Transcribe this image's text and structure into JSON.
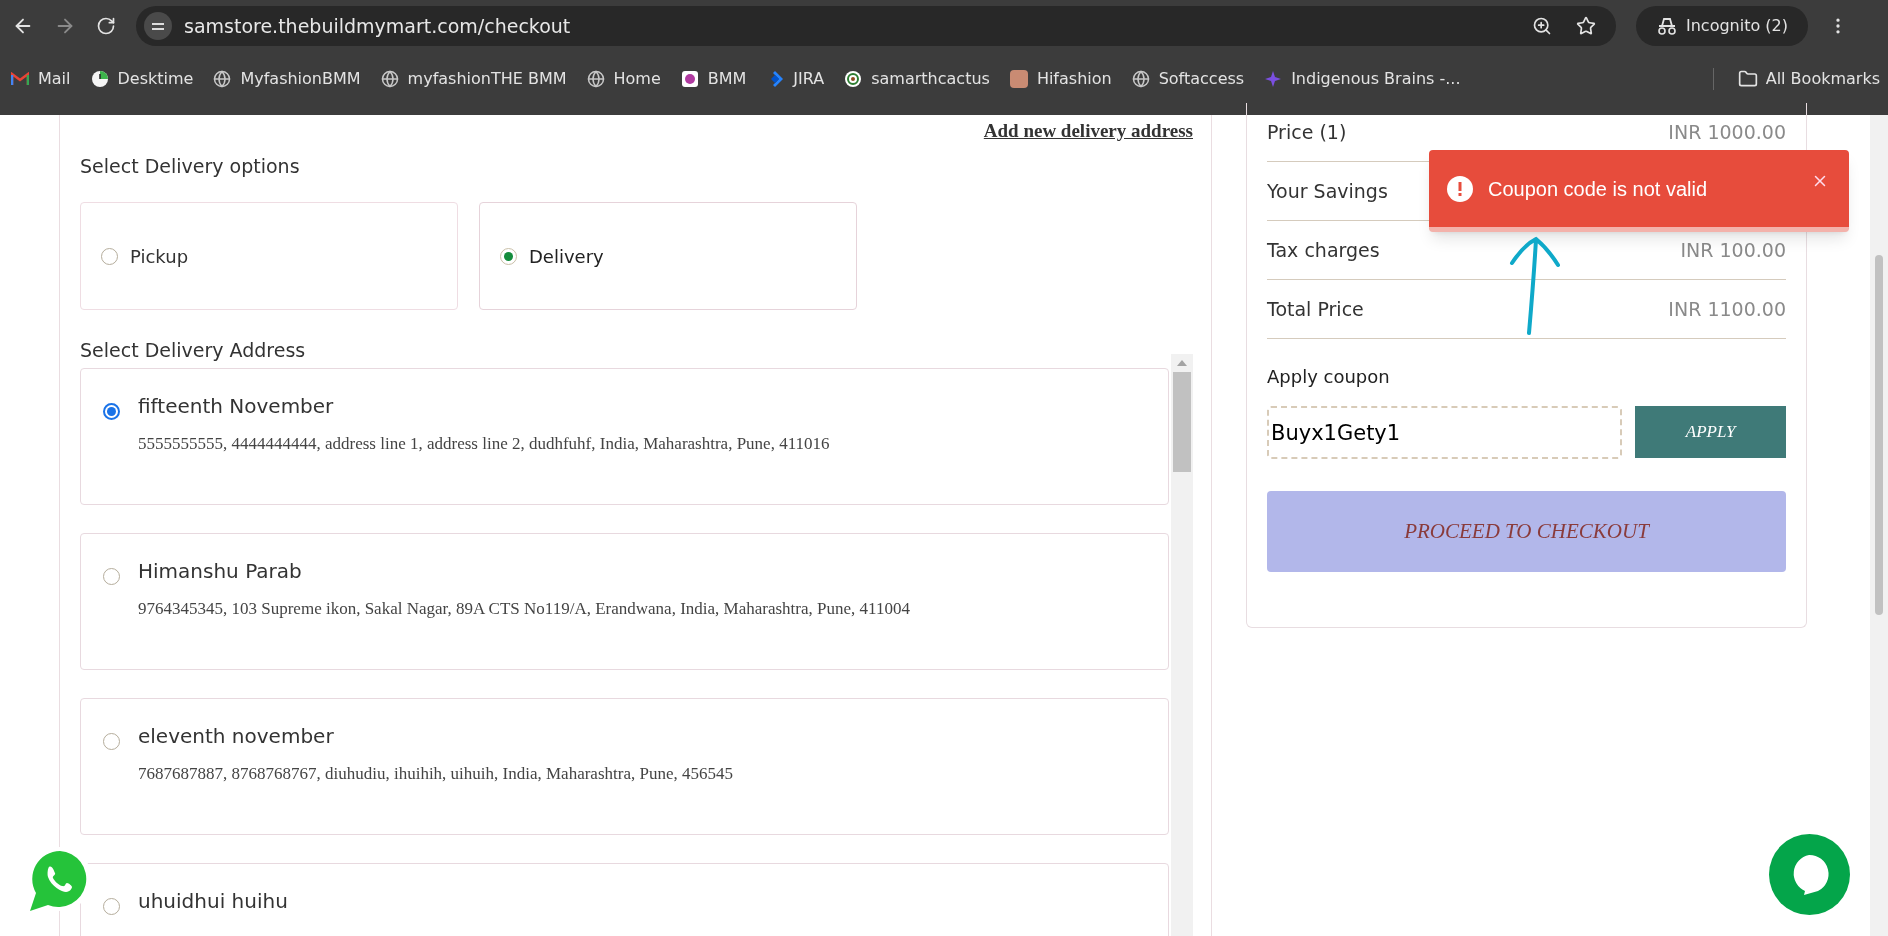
{
  "browser": {
    "url": "samstore.thebuildmymart.com/checkout",
    "profile": "Incognito (2)",
    "bookmarks": [
      {
        "label": "Mail",
        "kind": "mail"
      },
      {
        "label": "Desktime",
        "kind": "clock"
      },
      {
        "label": "MyfashionBMM",
        "kind": "globe"
      },
      {
        "label": "myfashionTHE BMM",
        "kind": "globe"
      },
      {
        "label": "Home",
        "kind": "globe"
      },
      {
        "label": "BMM",
        "kind": "badge"
      },
      {
        "label": "JIRA",
        "kind": "jira"
      },
      {
        "label": "samarthcactus",
        "kind": "ring"
      },
      {
        "label": "Hifashion",
        "kind": "photo"
      },
      {
        "label": "Softaccess",
        "kind": "globe"
      },
      {
        "label": "Indigenous Brains -...",
        "kind": "spark"
      }
    ],
    "all_bookmarks": "All Bookmarks"
  },
  "add_address_link": "Add new delivery address",
  "delivery_options": {
    "title": "Select Delivery options",
    "options": [
      {
        "label": "Pickup",
        "selected": false
      },
      {
        "label": "Delivery",
        "selected": true
      }
    ]
  },
  "address_section": {
    "title": "Select Delivery Address",
    "addresses": [
      {
        "name": "fifteenth November",
        "details": "5555555555, 4444444444, address line 1, address line 2, dudhfuhf, India, Maharashtra, Pune, 411016",
        "selected": true
      },
      {
        "name": "Himanshu Parab",
        "details": "9764345345, 103 Supreme ikon, Sakal Nagar, 89A CTS No119/A, Erandwana, India, Maharashtra, Pune, 411004",
        "selected": false
      },
      {
        "name": "eleventh november",
        "details": "7687687887, 8768768767, diuhudiu, ihuihih, uihuih, India, Maharashtra, Pune, 456545",
        "selected": false
      },
      {
        "name": "uhuidhui huihu",
        "selected": false
      }
    ]
  },
  "summary": {
    "rows": [
      {
        "label": "Price (1)",
        "value": "INR 1000.00"
      },
      {
        "label": "Your Savings"
      },
      {
        "label": "Tax charges",
        "value": "INR 100.00"
      },
      {
        "label": "Total Price",
        "value": "INR 1100.00"
      }
    ],
    "coupon": {
      "title": "Apply coupon",
      "value": "Buyx1Gety1",
      "apply_label": "APPLY"
    },
    "checkout_label": "PROCEED TO CHECKOUT"
  },
  "toast": {
    "message": "Coupon code is not valid"
  }
}
